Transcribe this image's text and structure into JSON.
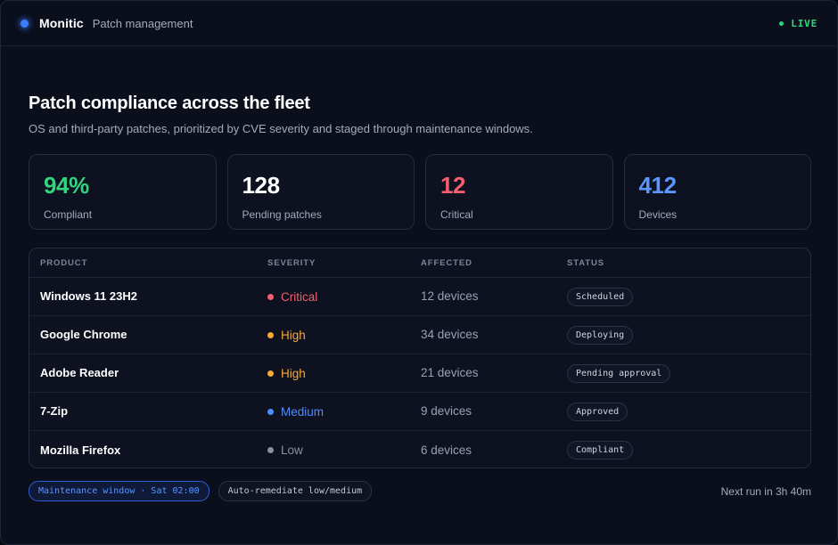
{
  "app": {
    "brand": "Monitic",
    "section": "Patch management",
    "live_label": "LIVE",
    "colors": {
      "accent": "#3b7bff",
      "live": "#2fd67c"
    }
  },
  "hero": {
    "title": "Patch compliance across the fleet",
    "description": "OS and third-party patches, prioritized by CVE severity and staged through maintenance windows."
  },
  "kpis": [
    {
      "value": "94%",
      "label": "Compliant",
      "color": "#34d37e"
    },
    {
      "value": "128",
      "label": "Pending patches",
      "color": "#ffffff"
    },
    {
      "value": "12",
      "label": "Critical",
      "color": "#f2606f"
    },
    {
      "value": "412",
      "label": "Devices",
      "color": "#5b95ff"
    }
  ],
  "table": {
    "headers": [
      "PRODUCT",
      "SEVERITY",
      "AFFECTED",
      "STATUS"
    ],
    "rows": [
      {
        "product": "Windows 11 23H2",
        "severity": "Critical",
        "severity_color": "#f2606f",
        "affected": "12 devices",
        "status": "Scheduled"
      },
      {
        "product": "Google Chrome",
        "severity": "High",
        "severity_color": "#f5a93b",
        "affected": "34 devices",
        "status": "Deploying"
      },
      {
        "product": "Adobe Reader",
        "severity": "High",
        "severity_color": "#f5a93b",
        "affected": "21 devices",
        "status": "Pending approval"
      },
      {
        "product": "7-Zip",
        "severity": "Medium",
        "severity_color": "#4f8dff",
        "affected": "9 devices",
        "status": "Approved"
      },
      {
        "product": "Mozilla Firefox",
        "severity": "Low",
        "severity_color": "#8a90a0",
        "affected": "6 devices",
        "status": "Compliant"
      }
    ]
  },
  "footer": {
    "maintenance_chip": "Maintenance window · Sat 02:00",
    "auto_remediate_chip": "Auto-remediate low/medium",
    "next_run": "Next run in 3h 40m"
  }
}
